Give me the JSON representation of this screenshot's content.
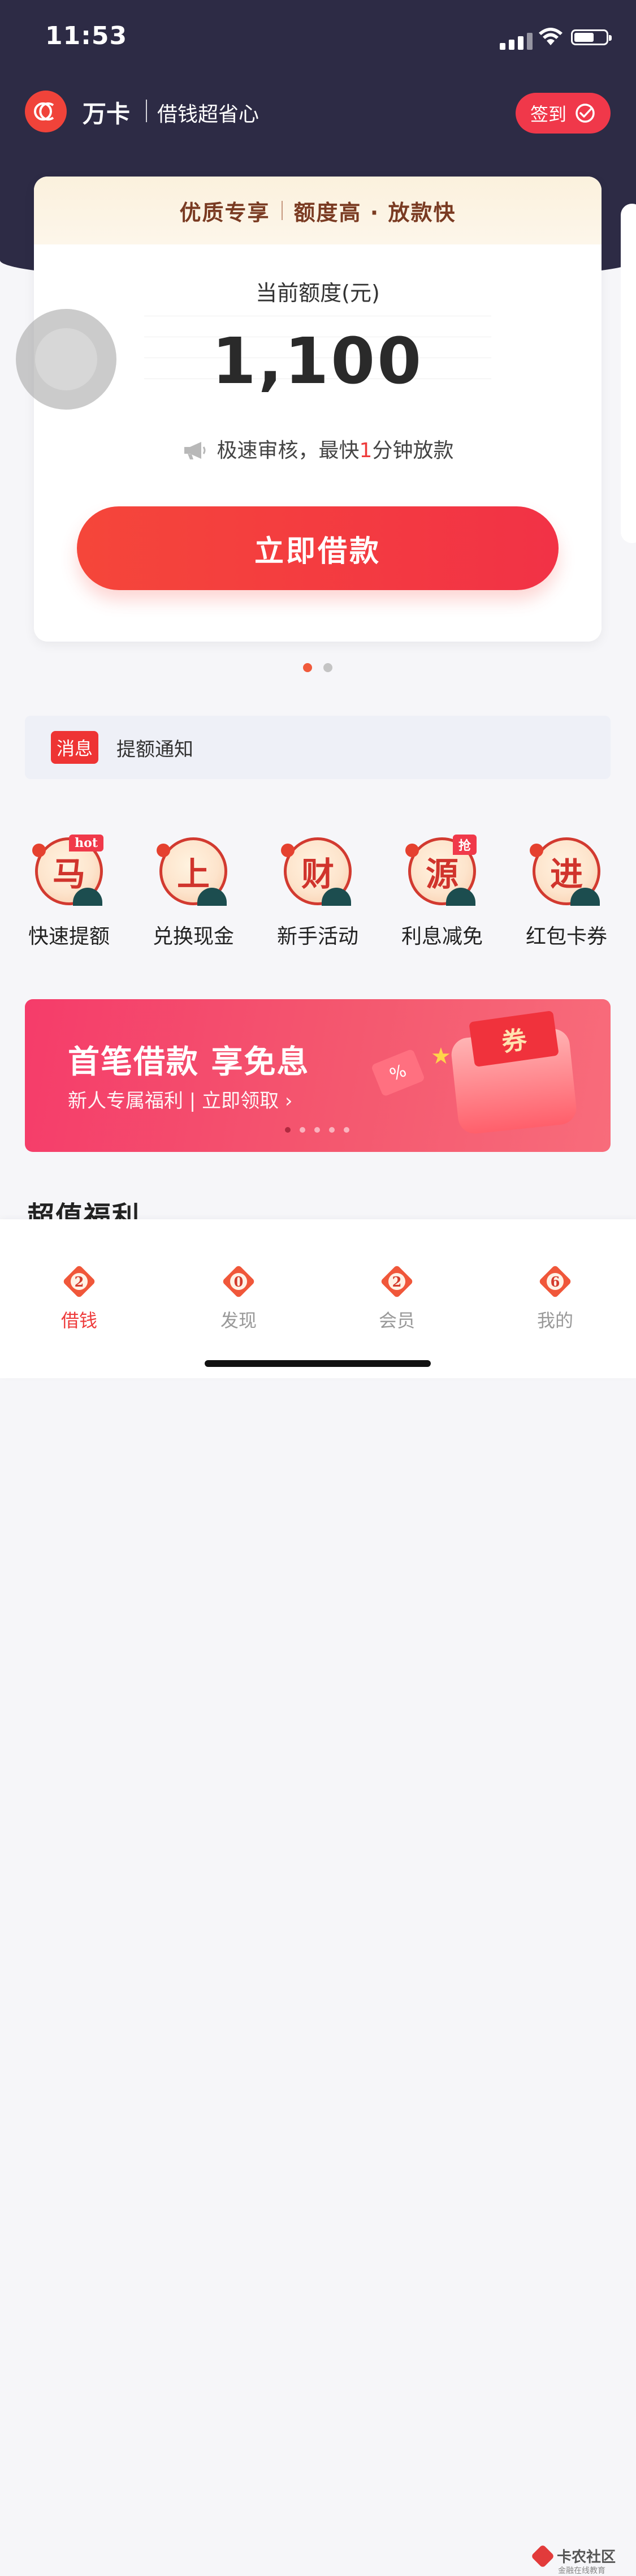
{
  "status_bar": {
    "time": "11:53"
  },
  "app_header": {
    "name": "万卡",
    "slogan": "借钱超省心",
    "signin_label": "签到"
  },
  "loan_card": {
    "banner_left": "优质专享",
    "banner_right": "额度高 · 放款快",
    "limit_label": "当前额度(元)",
    "limit_value": "1,100",
    "promo_prefix": "极速审核，最快",
    "promo_highlight": "1",
    "promo_suffix": "分钟放款",
    "borrow_button": "立即借款"
  },
  "carousel": {
    "total": 2,
    "active_index": 0
  },
  "notice": {
    "tag": "消息",
    "text": "提额通知"
  },
  "quick_entries": [
    {
      "glyph": "马",
      "label": "快速提额",
      "badge": "hot"
    },
    {
      "glyph": "上",
      "label": "兑换现金",
      "badge": ""
    },
    {
      "glyph": "财",
      "label": "新手活动",
      "badge": ""
    },
    {
      "glyph": "源",
      "label": "利息减免",
      "badge": "抢"
    },
    {
      "glyph": "进",
      "label": "红包卡券",
      "badge": ""
    }
  ],
  "banner": {
    "title": "首笔借款 享免息",
    "subtitle": "新人专属福利 | 立即领取 ›",
    "coupon_text": "券",
    "percent_text": "%",
    "total_slides": 5,
    "active_slide": 0
  },
  "section_title": "超值福利",
  "tabbar": [
    {
      "num": "2",
      "label": "借钱",
      "active": true
    },
    {
      "num": "0",
      "label": "发现",
      "active": false
    },
    {
      "num": "2",
      "label": "会员",
      "active": false
    },
    {
      "num": "6",
      "label": "我的",
      "active": false
    }
  ],
  "watermark": {
    "main": "卡农社区",
    "sub": "金融在线教育"
  },
  "colors": {
    "header_bg": "#2d2b45",
    "accent_red": "#f0384a",
    "highlight": "#ee3b3b"
  }
}
